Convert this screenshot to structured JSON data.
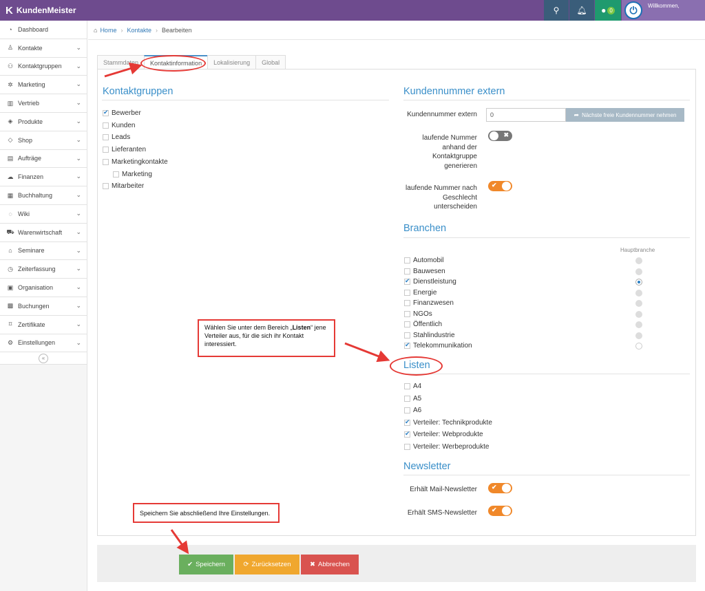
{
  "app": {
    "title": "KundenMeister",
    "user_label": "Willkommen,",
    "chat_count": "0"
  },
  "sidebar": {
    "items": [
      {
        "label": "Dashboard",
        "icon": "dashboard-icon",
        "glyph": "◔",
        "chevron": false
      },
      {
        "label": "Kontakte",
        "icon": "contacts-icon",
        "glyph": "♙",
        "chevron": true
      },
      {
        "label": "Kontaktgruppen",
        "icon": "groups-icon",
        "glyph": "⚇",
        "chevron": true
      },
      {
        "label": "Marketing",
        "icon": "marketing-icon",
        "glyph": "✲",
        "chevron": true
      },
      {
        "label": "Vertrieb",
        "icon": "sales-icon",
        "glyph": "▥",
        "chevron": true
      },
      {
        "label": "Produkte",
        "icon": "products-icon",
        "glyph": "◈",
        "chevron": true
      },
      {
        "label": "Shop",
        "icon": "shop-icon",
        "glyph": "◇",
        "chevron": true
      },
      {
        "label": "Aufträge",
        "icon": "orders-icon",
        "glyph": "▤",
        "chevron": true
      },
      {
        "label": "Finanzen",
        "icon": "finance-icon",
        "glyph": "☁",
        "chevron": true
      },
      {
        "label": "Buchhaltung",
        "icon": "accounting-icon",
        "glyph": "▦",
        "chevron": true
      },
      {
        "label": "Wiki",
        "icon": "wiki-icon",
        "glyph": "◌",
        "chevron": true
      },
      {
        "label": "Warenwirtschaft",
        "icon": "warehouse-icon",
        "glyph": "⛟",
        "chevron": true
      },
      {
        "label": "Seminare",
        "icon": "seminar-icon",
        "glyph": "⌂",
        "chevron": true
      },
      {
        "label": "Zeiterfassung",
        "icon": "clock-icon",
        "glyph": "◷",
        "chevron": true
      },
      {
        "label": "Organisation",
        "icon": "organisation-icon",
        "glyph": "▣",
        "chevron": true
      },
      {
        "label": "Buchungen",
        "icon": "calendar-icon",
        "glyph": "▩",
        "chevron": true
      },
      {
        "label": "Zertifikate",
        "icon": "certificate-icon",
        "glyph": "⌑",
        "chevron": true
      },
      {
        "label": "Einstellungen",
        "icon": "gear-icon",
        "glyph": "⚙",
        "chevron": true
      }
    ]
  },
  "breadcrumb": {
    "home": "Home",
    "contacts": "Kontakte",
    "current": "Bearbeiten"
  },
  "tabs": [
    "Stammdaten",
    "Kontaktinformation",
    "Lokalisierung",
    "Global"
  ],
  "kontaktgruppen": {
    "title": "Kontaktgruppen",
    "items": [
      {
        "label": "Bewerber",
        "checked": true
      },
      {
        "label": "Kunden",
        "checked": false
      },
      {
        "label": "Leads",
        "checked": false
      },
      {
        "label": "Lieferanten",
        "checked": false
      },
      {
        "label": "Marketingkontakte",
        "checked": false
      },
      {
        "label": "Marketing",
        "checked": false,
        "indent": true
      },
      {
        "label": "Mitarbeiter",
        "checked": false
      }
    ]
  },
  "kundennummer": {
    "title": "Kundennummer extern",
    "field_label": "Kundennummer extern",
    "field_value": "0",
    "next_button": "Nächste freie Kundennummer nehmen",
    "toggle1_label": "laufende Nummer anhand der Kontaktgruppe generieren",
    "toggle1_on": false,
    "toggle2_label": "laufende Nummer nach Geschlecht unterscheiden",
    "toggle2_on": true
  },
  "branchen": {
    "title": "Branchen",
    "haupt_label": "Hauptbranche",
    "items": [
      {
        "label": "Automobil",
        "checked": false,
        "main": false
      },
      {
        "label": "Bauwesen",
        "checked": false,
        "main": false
      },
      {
        "label": "Dienstleistung",
        "checked": true,
        "main": true
      },
      {
        "label": "Energie",
        "checked": false,
        "main": false
      },
      {
        "label": "Finanzwesen",
        "checked": false,
        "main": false
      },
      {
        "label": "NGOs",
        "checked": false,
        "main": false
      },
      {
        "label": "Öffentlich",
        "checked": false,
        "main": false
      },
      {
        "label": "Stahlindustrie",
        "checked": false,
        "main": false
      },
      {
        "label": "Telekommunikation",
        "checked": true,
        "main": false
      }
    ]
  },
  "listen": {
    "title": "Listen",
    "items": [
      {
        "label": "A4",
        "checked": false
      },
      {
        "label": "A5",
        "checked": false
      },
      {
        "label": "A6",
        "checked": false
      },
      {
        "label": "Verteiler: Technikprodukte",
        "checked": true
      },
      {
        "label": "Verteiler: Webprodukte",
        "checked": true
      },
      {
        "label": "Verteiler: Werbeprodukte",
        "checked": false
      }
    ]
  },
  "newsletter": {
    "title": "Newsletter",
    "mail_label": "Erhält Mail-Newsletter",
    "mail_on": true,
    "sms_label": "Erhält SMS-Newsletter",
    "sms_on": true
  },
  "footer": {
    "save": "Speichern",
    "reset": "Zurücksetzen",
    "cancel": "Abbrechen"
  },
  "annotations": {
    "listen_pre": "Wählen Sie unter dem Bereich „",
    "listen_bold": "Listen",
    "listen_post": "“ jene Verteiler aus, für die sich ihr Kontakt interessiert.",
    "save_note": "Speichern Sie abschließend Ihre Einstellungen."
  },
  "colors": {
    "topbar": "#6e4b8e",
    "accent": "#3a8fc9",
    "save": "#6aaf5e",
    "reset": "#f0a72e",
    "cancel": "#d9534f",
    "annotation": "#e53935"
  }
}
